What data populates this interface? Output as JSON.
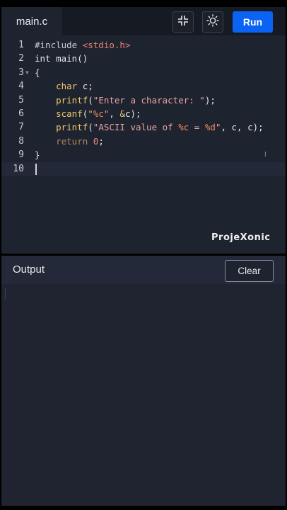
{
  "editor": {
    "tab_label": "main.c",
    "run_label": "Run",
    "lines": [
      {
        "num": "1"
      },
      {
        "num": "2"
      },
      {
        "num": "3"
      },
      {
        "num": "4"
      },
      {
        "num": "5"
      },
      {
        "num": "6"
      },
      {
        "num": "7"
      },
      {
        "num": "8"
      },
      {
        "num": "9"
      },
      {
        "num": "10"
      }
    ],
    "code": {
      "l1_include": "#include ",
      "l1_header": "<stdio.h>",
      "l2": "int main()",
      "l3": "{",
      "l4_kw": "char",
      "l4_rest": " c;",
      "l5_fn": "printf",
      "l5_open": "(",
      "l5_str": "\"Enter a character: \"",
      "l5_close": ");",
      "l6_fn": "scanf",
      "l6_open": "(",
      "l6_str_a": "\"",
      "l6_fmt": "%c",
      "l6_str_b": "\"",
      "l6_mid": ", ",
      "l6_amp": "&",
      "l6_end": "c);",
      "l7_fn": "printf",
      "l7_open": "(",
      "l7_str_a": "\"ASCII value of ",
      "l7_fmt_a": "%c",
      "l7_str_b": " = ",
      "l7_fmt_b": "%d",
      "l7_str_c": "\"",
      "l7_end": ", c, c);",
      "l8_kw": "return",
      "l8_sp": " ",
      "l8_num": "0",
      "l8_end": ";",
      "l9": "}"
    },
    "icons": {
      "collapse": "collapse-icon",
      "theme": "sun-icon"
    }
  },
  "watermark": "ProjeXonic",
  "output": {
    "title": "Output",
    "clear_label": "Clear"
  }
}
